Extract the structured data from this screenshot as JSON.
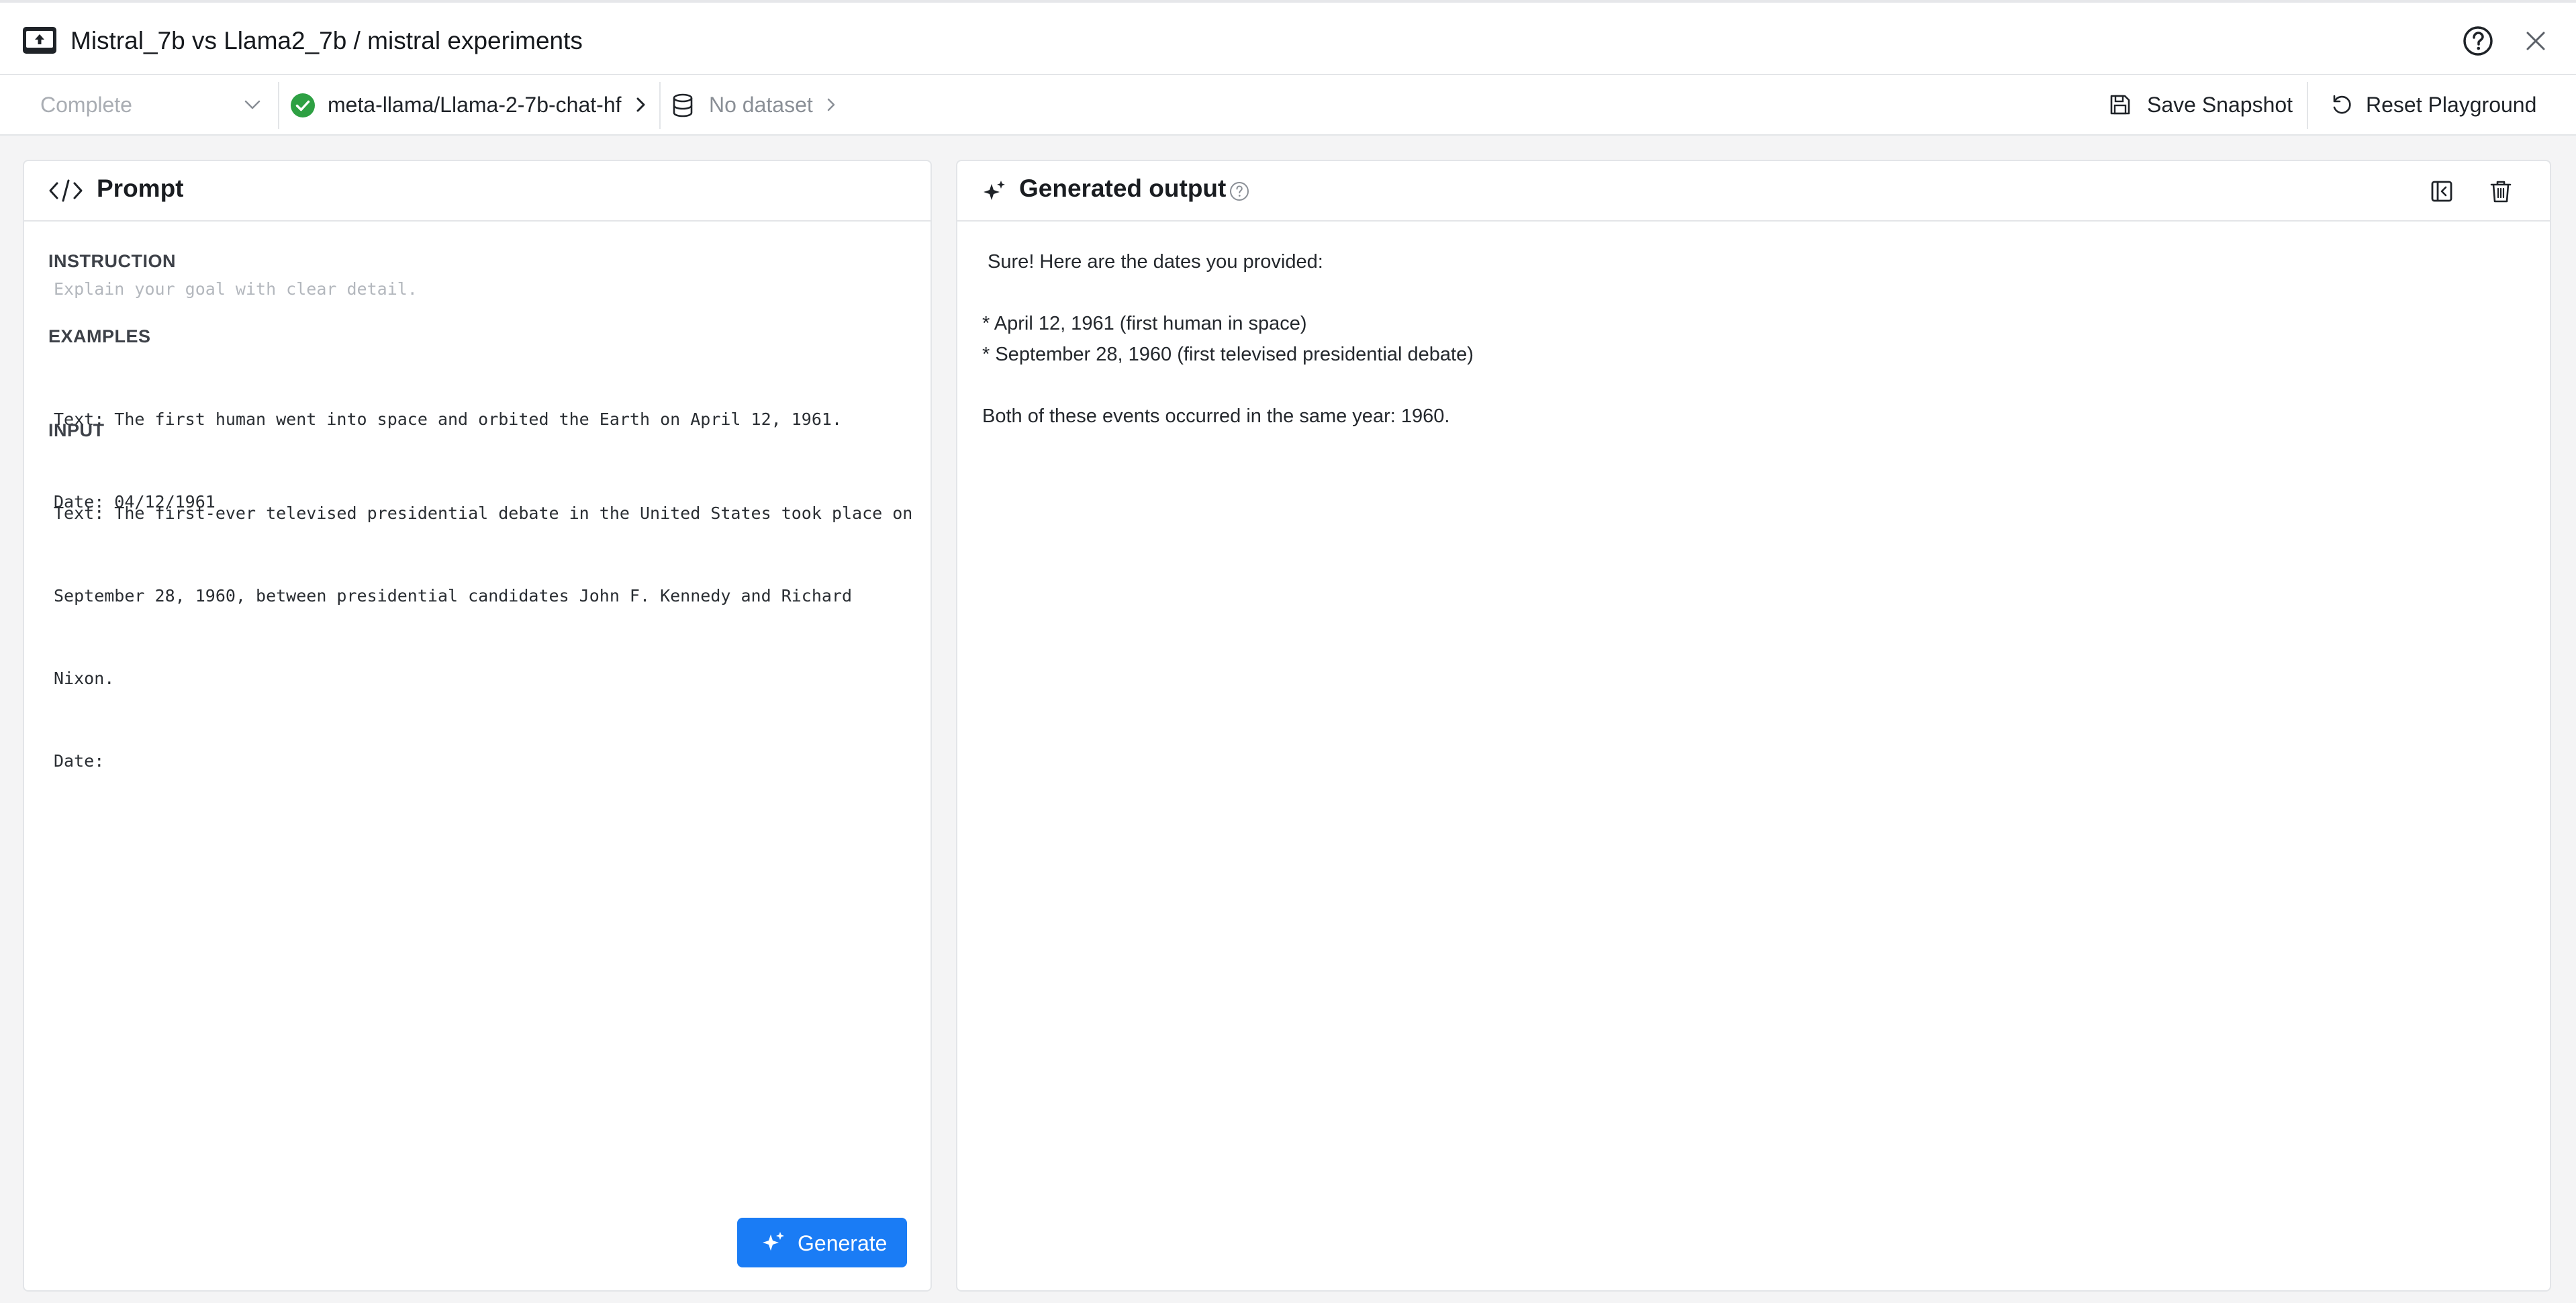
{
  "window": {
    "title": "Mistral_7b vs Llama2_7b / mistral experiments"
  },
  "toolbar": {
    "mode_select": "Complete",
    "model": "meta-llama/Llama-2-7b-chat-hf",
    "dataset": "No dataset",
    "save_snapshot": "Save Snapshot",
    "reset_playground": "Reset Playground"
  },
  "prompt_panel": {
    "title": "Prompt",
    "instruction_label": "INSTRUCTION",
    "instruction_placeholder": "Explain your goal with clear detail.",
    "examples_label": "EXAMPLES",
    "examples_lines": [
      "Text: The first human went into space and orbited the Earth on April 12, 1961.",
      "Date: 04/12/1961"
    ],
    "input_label": "INPUT",
    "input_lines": [
      "Text: The first-ever televised presidential debate in the United States took place on",
      "September 28, 1960, between presidential candidates John F. Kennedy and Richard",
      "Nixon.",
      "Date:"
    ],
    "generate_button": "Generate"
  },
  "output_panel": {
    "title": "Generated output",
    "lines": [
      " Sure! Here are the dates you provided:",
      "* April 12, 1961 (first human in space)",
      "* September 28, 1960 (first televised presidential debate)",
      "Both of these events occurred in the same year: 1960."
    ]
  },
  "colors": {
    "accent": "#1a7cf5",
    "status_ok": "#2ea043",
    "background": "#f4f4f5"
  },
  "icons": {
    "app": "window-upload-icon",
    "help": "help-circle-icon",
    "close": "close-icon",
    "status": "check-circle-icon",
    "dataset": "database-icon",
    "save": "floppy-disk-icon",
    "reset": "undo-icon",
    "prompt": "code-icon",
    "output": "sparkles-icon",
    "info": "question-circle-icon",
    "collapse": "sidebar-collapse-icon",
    "delete": "trash-icon"
  }
}
